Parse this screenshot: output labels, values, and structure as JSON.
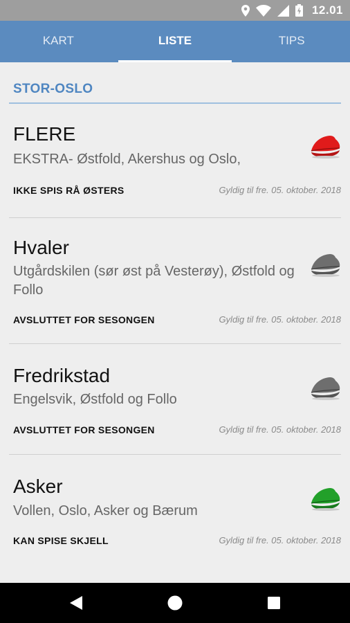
{
  "status_bar": {
    "time": "12.01",
    "icons": [
      "location-icon",
      "wifi-icon",
      "signal-icon",
      "battery-icon"
    ]
  },
  "tabs": [
    {
      "label": "KART",
      "active": false
    },
    {
      "label": "LISTE",
      "active": true
    },
    {
      "label": "TIPS",
      "active": false
    }
  ],
  "section": {
    "title": "STOR-OSLO"
  },
  "items": [
    {
      "title": "FLERE",
      "subtitle": "EKSTRA- Østfold, Akershus og Oslo,",
      "status": "IKKE SPIS RÅ ØSTERS",
      "valid": "Gyldig til fre. 05. oktober. 2018",
      "icon": "oyster-red-icon",
      "color": "#e01b1b"
    },
    {
      "title": "Hvaler",
      "subtitle": "Utgårdskilen (sør øst på Vesterøy), Østfold og Follo",
      "status": "AVSLUTTET FOR SESONGEN",
      "valid": "Gyldig til fre. 05. oktober. 2018",
      "icon": "oyster-grey-icon",
      "color": "#6e6e6e"
    },
    {
      "title": "Fredrikstad",
      "subtitle": "Engelsvik, Østfold og Follo",
      "status": "AVSLUTTET FOR SESONGEN",
      "valid": "Gyldig til fre. 05. oktober. 2018",
      "icon": "oyster-grey-icon",
      "color": "#6e6e6e"
    },
    {
      "title": "Asker",
      "subtitle": "Vollen, Oslo, Asker og Bærum",
      "status": "KAN SPISE SKJELL",
      "valid": "Gyldig til fre. 05. oktober. 2018",
      "icon": "oyster-green-icon",
      "color": "#22a02a"
    }
  ],
  "colors": {
    "app_bar": "#5b8bbf",
    "section_title": "#4f86c1",
    "status_bar": "#9e9e9e"
  }
}
